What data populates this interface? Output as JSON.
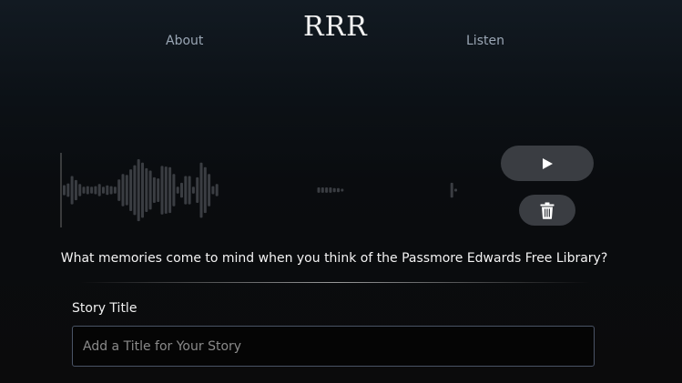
{
  "nav": {
    "about_label": "About",
    "logo_text": "RRR",
    "listen_label": "Listen"
  },
  "player": {
    "play_icon": "play-icon",
    "delete_icon": "trash-icon",
    "waveform_bar_levels": [
      0.15,
      0.2,
      0.42,
      0.3,
      0.18,
      0.1,
      0.12,
      0.1,
      0.12,
      0.18,
      0.1,
      0.14,
      0.12,
      0.1,
      0.32,
      0.48,
      0.45,
      0.62,
      0.74,
      0.92,
      0.82,
      0.65,
      0.58,
      0.38,
      0.35,
      0.72,
      0.7,
      0.68,
      0.48,
      0.1,
      0.22,
      0.42,
      0.42,
      0.1,
      0.38,
      0.82,
      0.68,
      0.48,
      0.12,
      0.18,
      0.0,
      0.0,
      0.0,
      0.0,
      0.0,
      0.0,
      0.0,
      0.0,
      0.0,
      0.0,
      0.0,
      0.0,
      0.0,
      0.0,
      0.0,
      0.0,
      0.0,
      0.0,
      0.0,
      0.0,
      0.0,
      0.0,
      0.0,
      0.0,
      0.0,
      0.08,
      0.08,
      0.08,
      0.08,
      0.06,
      0.06,
      0.04,
      0.0,
      0.0,
      0.0,
      0.0,
      0.0,
      0.0,
      0.0,
      0.0,
      0.0,
      0.0,
      0.0,
      0.0,
      0.0,
      0.0,
      0.0,
      0.0,
      0.0,
      0.0,
      0.0,
      0.0,
      0.0,
      0.0,
      0.0,
      0.0,
      0.0,
      0.0,
      0.0,
      0.22,
      0.04
    ],
    "colors": {
      "waveform_bar": "#3a3d42",
      "cursor_line": "#6a6a6a",
      "button_bg": "#3a3d42"
    }
  },
  "prompt": {
    "text": "What memories come to mind when you think of the Passmore Edwards Free Library?"
  },
  "form": {
    "title_label": "Story Title",
    "title_value": "",
    "title_placeholder": "Add a Title for Your Story"
  }
}
